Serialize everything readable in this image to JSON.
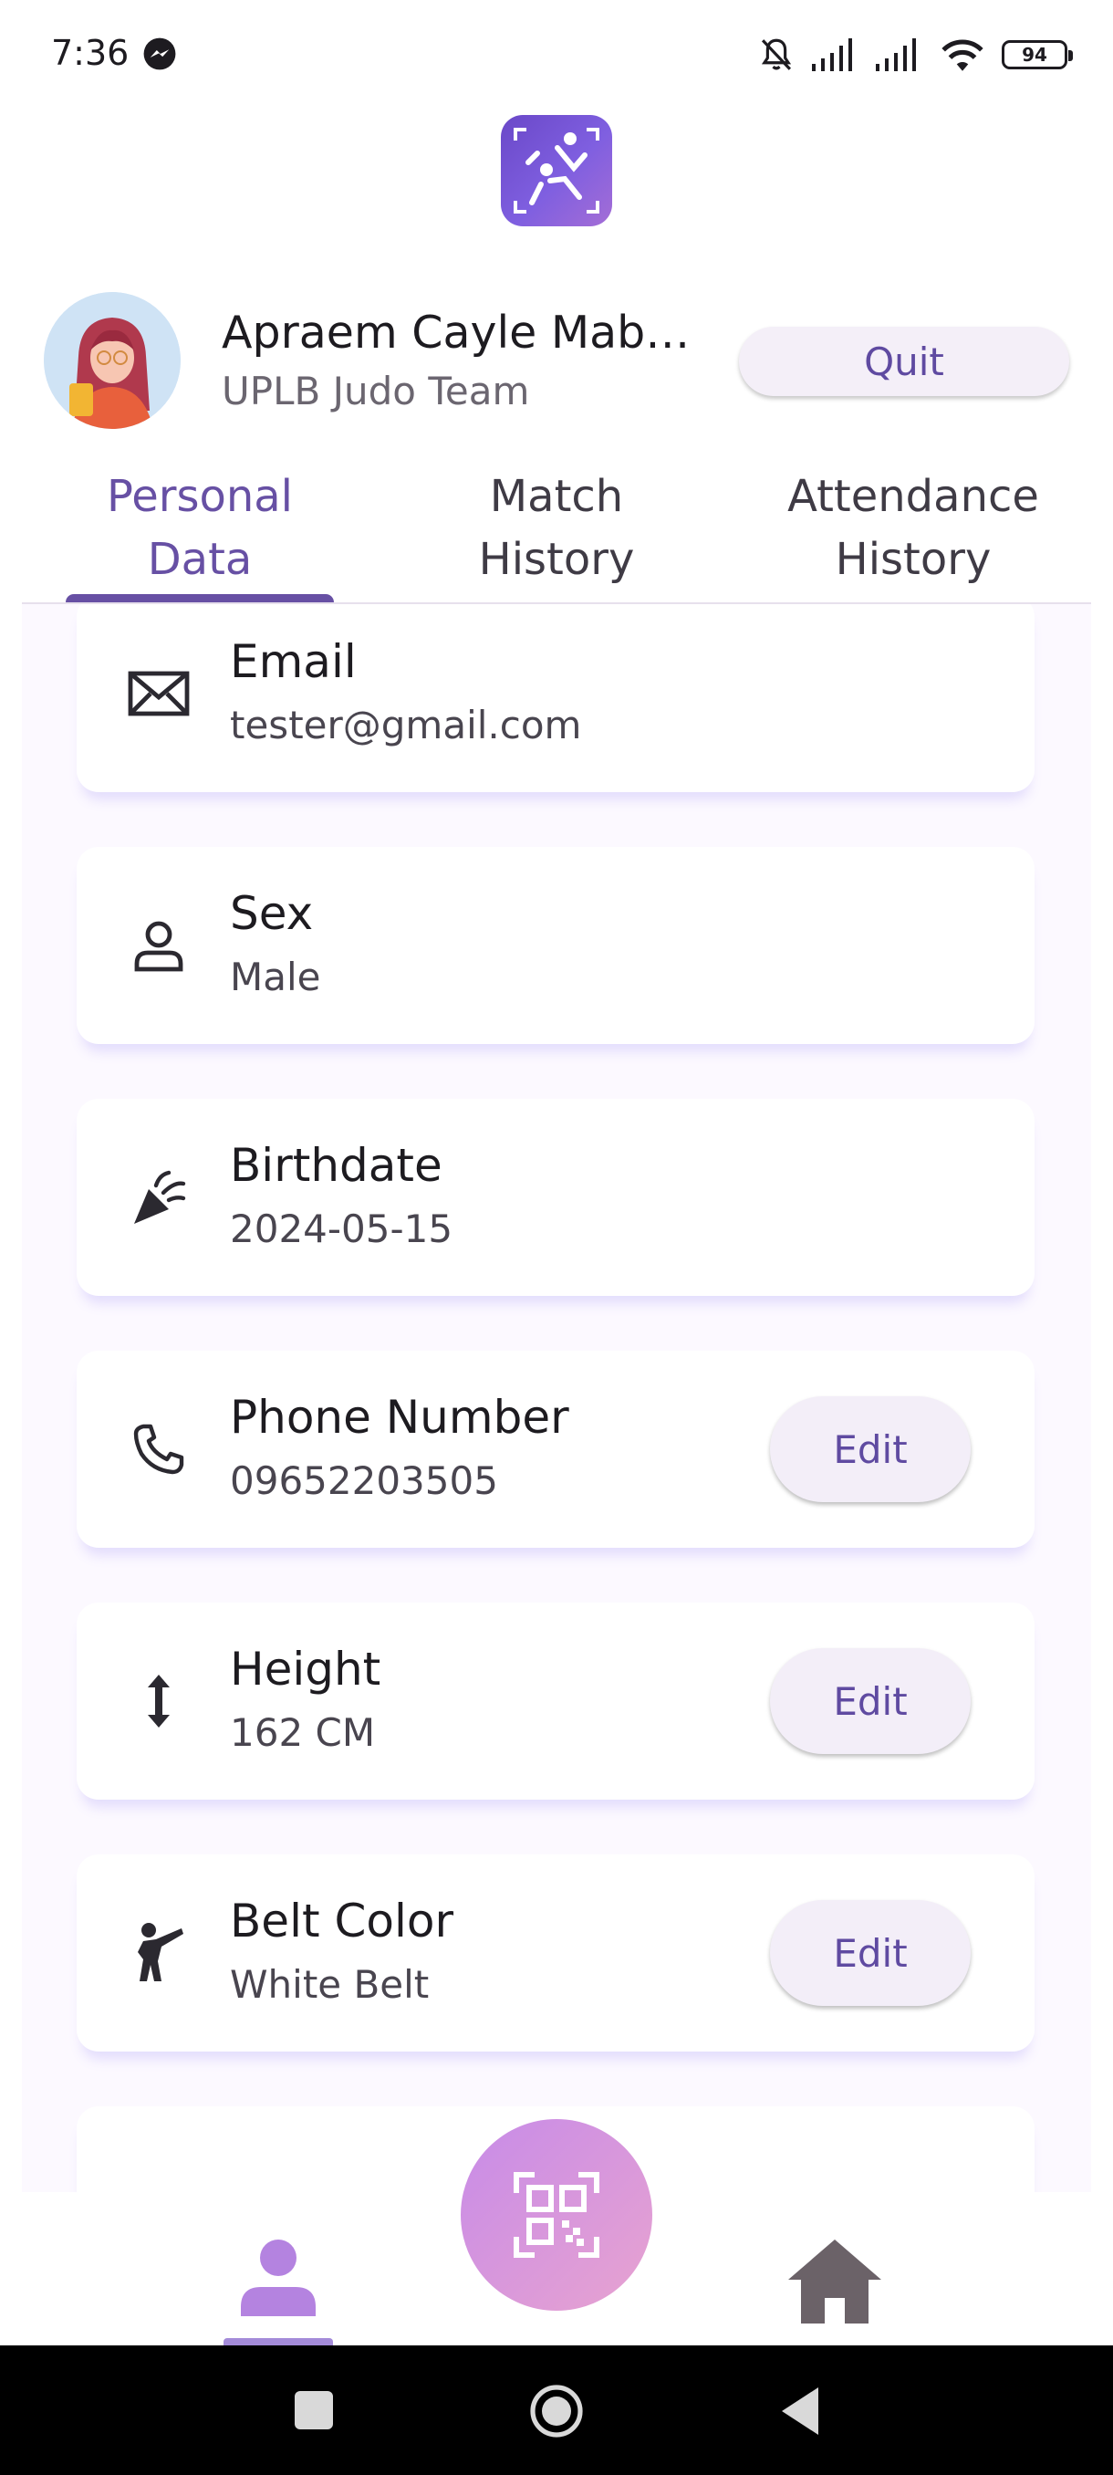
{
  "status_bar": {
    "time": "7:36",
    "battery": "94"
  },
  "profile": {
    "name": "Apraem Cayle Maba...",
    "team": "UPLB Judo Team",
    "quit_label": "Quit"
  },
  "tabs": [
    {
      "label": "Personal\nData",
      "active": true
    },
    {
      "label": "Match\nHistory",
      "active": false
    },
    {
      "label": "Attendance\nHistory",
      "active": false
    }
  ],
  "fields": [
    {
      "icon": "mail-icon",
      "title": "Email",
      "value": "tester@gmail.com"
    },
    {
      "icon": "person-icon",
      "title": "Sex",
      "value": "Male"
    },
    {
      "icon": "party-popper-icon",
      "title": "Birthdate",
      "value": "2024-05-15"
    },
    {
      "icon": "phone-icon",
      "title": "Phone Number",
      "value": "09652203505",
      "edit_label": "Edit"
    },
    {
      "icon": "height-arrows-icon",
      "title": "Height",
      "value": "162 CM",
      "edit_label": "Edit"
    },
    {
      "icon": "martial-arts-kick-icon",
      "title": "Belt Color",
      "value": "White Belt",
      "edit_label": "Edit"
    }
  ],
  "bottom_nav": {
    "active": "profile",
    "items": [
      "profile-icon",
      "qr-scan-icon",
      "home-icon"
    ]
  },
  "colors": {
    "accent": "#6750a4",
    "fab_start": "#c78be8",
    "fab_end": "#e8a3d0",
    "logo": "#7f5fe0"
  }
}
